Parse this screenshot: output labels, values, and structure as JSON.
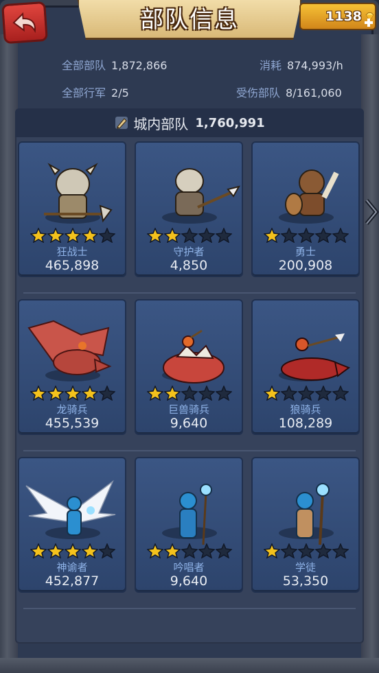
{
  "header": {
    "title": "部队信息",
    "gems": "1138"
  },
  "stats": {
    "total_troops_label": "全部部队",
    "total_troops_value": "1,872,866",
    "consumption_label": "消耗",
    "consumption_value": "874,993/h",
    "marching_label": "全部行军",
    "marching_value": "2/5",
    "wounded_label": "受伤部队",
    "wounded_value": "8/161,060"
  },
  "panel": {
    "title": "城内部队",
    "count": "1,760,991"
  },
  "units": [
    {
      "name": "狂战士",
      "count": "465,898",
      "stars": 4,
      "kind": "berserker"
    },
    {
      "name": "守护者",
      "count": "4,850",
      "stars": 2,
      "kind": "guardian"
    },
    {
      "name": "勇士",
      "count": "200,908",
      "stars": 1,
      "kind": "warrior"
    },
    {
      "name": "龙骑兵",
      "count": "455,539",
      "stars": 4,
      "kind": "dragon"
    },
    {
      "name": "巨兽骑兵",
      "count": "9,640",
      "stars": 2,
      "kind": "beast"
    },
    {
      "name": "狼骑兵",
      "count": "108,289",
      "stars": 1,
      "kind": "wolf"
    },
    {
      "name": "神谕者",
      "count": "452,877",
      "stars": 4,
      "kind": "oracle"
    },
    {
      "name": "吟唱者",
      "count": "9,640",
      "stars": 2,
      "kind": "chanter"
    },
    {
      "name": "学徒",
      "count": "53,350",
      "stars": 1,
      "kind": "apprentice"
    }
  ],
  "colors": {
    "star_on": "#f4c21c",
    "star_off": "#1f2a3d",
    "accent": "#8fa7d2"
  }
}
